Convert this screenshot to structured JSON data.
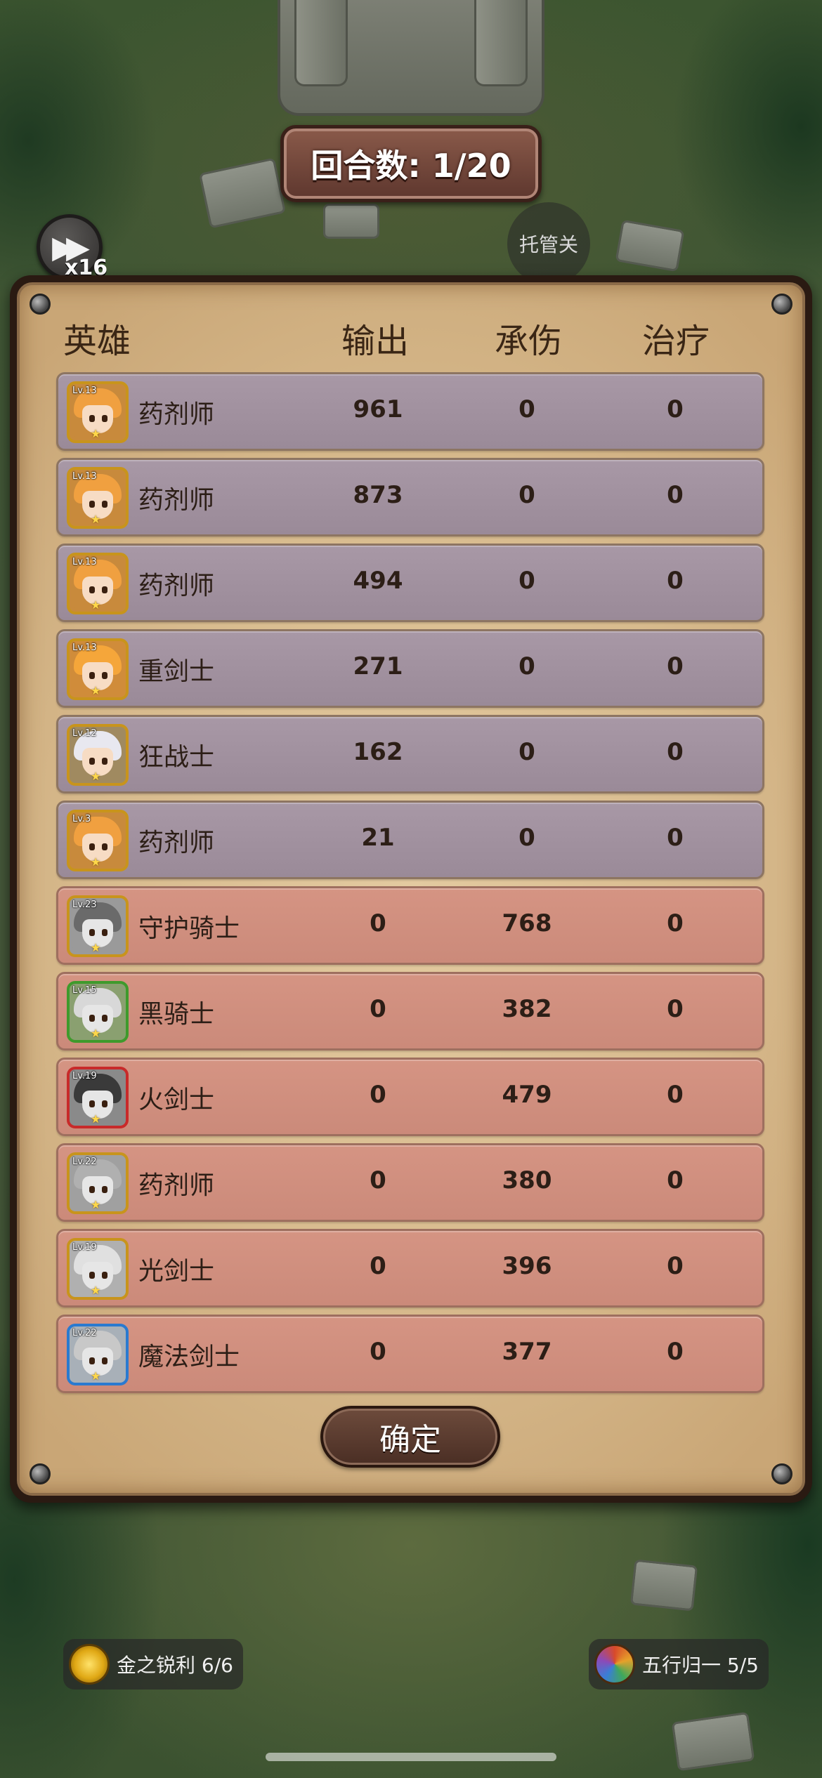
{
  "hud": {
    "round_label": "回合数: 1/20",
    "speed_label": "x16",
    "auto_label": "托管关"
  },
  "table": {
    "headers": {
      "hero": "英雄",
      "output": "输出",
      "tank": "承伤",
      "heal": "治疗"
    },
    "rows": [
      {
        "side": "ally",
        "level": "Lv.13",
        "name": "药剂师",
        "output": "961",
        "tank": "0",
        "heal": "0"
      },
      {
        "side": "ally",
        "level": "Lv.13",
        "name": "药剂师",
        "output": "873",
        "tank": "0",
        "heal": "0"
      },
      {
        "side": "ally",
        "level": "Lv.13",
        "name": "药剂师",
        "output": "494",
        "tank": "0",
        "heal": "0"
      },
      {
        "side": "ally",
        "level": "Lv.13",
        "name": "重剑士",
        "output": "271",
        "tank": "0",
        "heal": "0"
      },
      {
        "side": "ally",
        "level": "Lv.12",
        "name": "狂战士",
        "output": "162",
        "tank": "0",
        "heal": "0"
      },
      {
        "side": "ally",
        "level": "Lv.3",
        "name": "药剂师",
        "output": "21",
        "tank": "0",
        "heal": "0"
      },
      {
        "side": "enemy",
        "level": "Lv.23",
        "name": "守护骑士",
        "output": "0",
        "tank": "768",
        "heal": "0"
      },
      {
        "side": "enemy",
        "level": "Lv.15",
        "name": "黑骑士",
        "output": "0",
        "tank": "382",
        "heal": "0"
      },
      {
        "side": "enemy",
        "level": "Lv.19",
        "name": "火剑士",
        "output": "0",
        "tank": "479",
        "heal": "0"
      },
      {
        "side": "enemy",
        "level": "Lv.22",
        "name": "药剂师",
        "output": "0",
        "tank": "380",
        "heal": "0"
      },
      {
        "side": "enemy",
        "level": "Lv.19",
        "name": "光剑士",
        "output": "0",
        "tank": "396",
        "heal": "0"
      },
      {
        "side": "enemy",
        "level": "Lv.22",
        "name": "魔法剑士",
        "output": "0",
        "tank": "377",
        "heal": "0"
      }
    ]
  },
  "confirm_label": "确定",
  "buffs": {
    "left": {
      "icon": "gold-medal-icon",
      "label": "金之锐利 6/6"
    },
    "right": {
      "icon": "five-elements-icon",
      "label": "五行归一 5/5"
    }
  },
  "colors": {
    "ally_row": "#a898a6",
    "enemy_row": "#d59483",
    "panel": "#d8bb8e"
  }
}
